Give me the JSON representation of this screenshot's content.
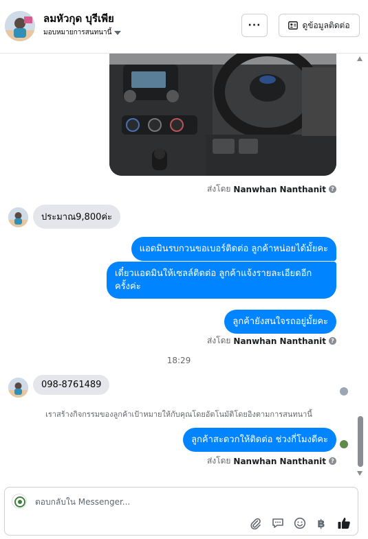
{
  "header": {
    "contact_name": "ลมหัวกุด บุรีเพีย",
    "assignment_label": "มอบหมายการสนทนานี้",
    "more_label": "···",
    "view_contact_label": "ดูข้อมูลติดต่อ"
  },
  "messages": {
    "sent_by_prefix": "ส่งโดย",
    "sender_name": "Nanwhan Nanthanit",
    "incoming_price": "ประมาณ9,800ค่ะ",
    "out_1": "แอดมินรบกวนขอเบอร์ติดต่อ ลูกค้าหน่อยได้มั้ยคะ",
    "out_2_line1": "เดี๋ยวแอดมินให้เซลล์ติดต่อ ลูกค้าแจ้งรายละเอียดอีก",
    "out_2_line2": "ครั้งค่ะ",
    "out_3": "ลูกค้ายังสนใจรถอยู่มั้ยคะ",
    "timestamp": "18:29",
    "incoming_phone": "098-8761489",
    "activity_notice": "เราสร้างกิจกรรมของลูกค้าเป้าหมายให้กับคุณโดยอัตโนมัติโดยอิงตามการสนทนานี้",
    "out_4": "ลูกค้าสะดวกให้ติดต่อ ช่วงกี่โมงดีคะ"
  },
  "composer": {
    "placeholder": "ตอบกลับใน Messenger..."
  },
  "icons": [
    "more-icon",
    "contact-card-icon",
    "info-icon",
    "attach-icon",
    "saved-reply-icon",
    "emoji-icon",
    "baht-icon",
    "like-icon"
  ],
  "colors": {
    "outgoing_bubble": "#0084ff",
    "incoming_bubble": "#e4e6eb",
    "muted_text": "#65676b"
  }
}
